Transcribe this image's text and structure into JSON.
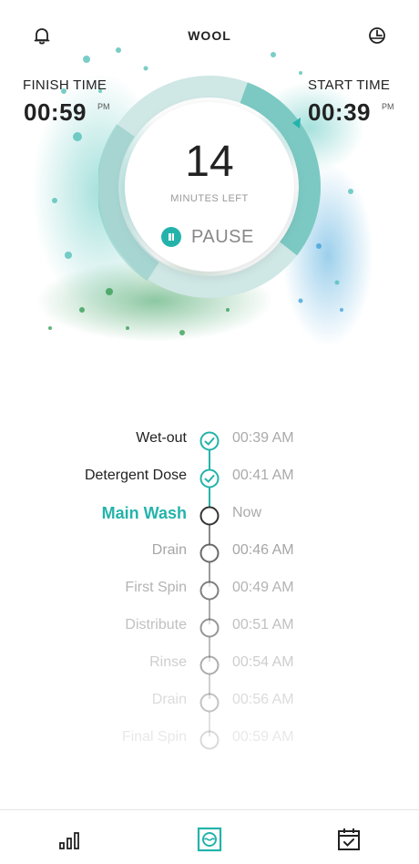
{
  "header": {
    "program": "WOOL",
    "bell_icon": "bell-icon",
    "history_icon": "timer-history-icon"
  },
  "times": {
    "finish_label": "FINISH TIME",
    "finish_value": "00:59",
    "finish_ampm": "PM",
    "start_label": "START TIME",
    "start_value": "00:39",
    "start_ampm": "PM"
  },
  "dial": {
    "minutes": "14",
    "minutes_label": "MINUTES LEFT",
    "pause_label": "PAUSE",
    "progress_fraction": 0.3
  },
  "steps": [
    {
      "name": "Wet-out",
      "time": "00:39 AM",
      "state": "done"
    },
    {
      "name": "Detergent Dose",
      "time": "00:41 AM",
      "state": "done"
    },
    {
      "name": "Main Wash",
      "time": "Now",
      "state": "current"
    },
    {
      "name": "Drain",
      "time": "00:46 AM",
      "state": "upcoming"
    },
    {
      "name": "First Spin",
      "time": "00:49 AM",
      "state": "upcoming"
    },
    {
      "name": "Distribute",
      "time": "00:51 AM",
      "state": "upcoming"
    },
    {
      "name": "Rinse",
      "time": "00:54 AM",
      "state": "upcoming"
    },
    {
      "name": "Drain",
      "time": "00:56 AM",
      "state": "upcoming"
    },
    {
      "name": "Final Spin",
      "time": "00:59 AM",
      "state": "upcoming"
    }
  ],
  "nav": {
    "items": [
      "stats-icon",
      "washer-icon",
      "schedule-icon"
    ]
  },
  "colors": {
    "accent": "#24b3ab",
    "check": "#24b3ab",
    "node": "#555555"
  }
}
